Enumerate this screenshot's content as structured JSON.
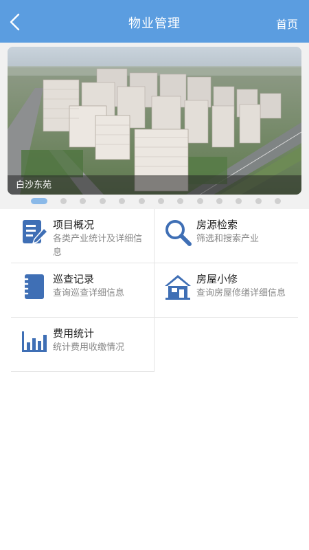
{
  "header": {
    "title": "物业管理",
    "home_label": "首页",
    "color": "#5b9de0"
  },
  "banner": {
    "caption": "白沙东苑",
    "slide_count": 13,
    "active_index": 0
  },
  "menu": [
    {
      "title": "项目概况",
      "desc": "各类产业统计及详细信息",
      "icon": "document-edit-icon"
    },
    {
      "title": "房源检索",
      "desc": "筛选和搜索产业",
      "icon": "magnifier-icon"
    },
    {
      "title": "巡查记录",
      "desc": "查询巡查详细信息",
      "icon": "notebook-icon"
    },
    {
      "title": "房屋小修",
      "desc": "查询房屋修缮详细信息",
      "icon": "house-icon"
    },
    {
      "title": "费用统计",
      "desc": "统计费用收缴情况",
      "icon": "bar-chart-icon"
    }
  ],
  "accent": "#3f6fb5"
}
